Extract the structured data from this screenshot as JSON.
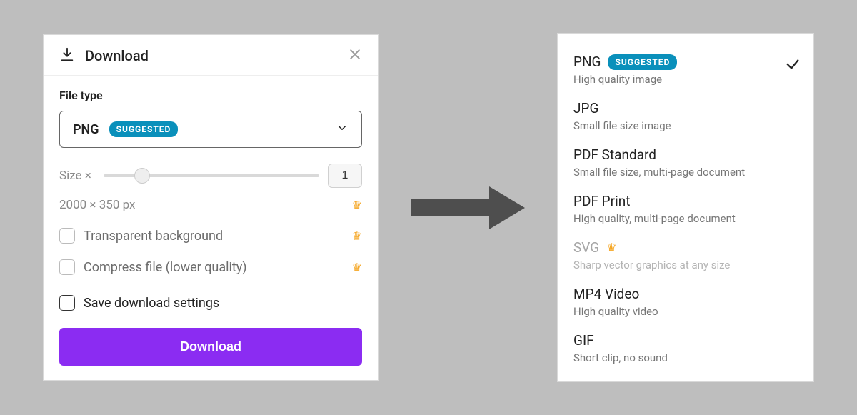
{
  "panel": {
    "title": "Download",
    "file_type_label": "File type",
    "selected_type": "PNG",
    "suggested_badge": "SUGGESTED",
    "size_label": "Size ×",
    "size_value": "1",
    "dimensions": "2000 × 350 px",
    "opt_transparent": "Transparent background",
    "opt_compress": "Compress file (lower quality)",
    "opt_save_settings": "Save download settings",
    "download_btn": "Download"
  },
  "types": [
    {
      "name": "PNG",
      "desc": "High quality image",
      "suggested": true,
      "selected": true,
      "pro": false
    },
    {
      "name": "JPG",
      "desc": "Small file size image",
      "suggested": false,
      "selected": false,
      "pro": false
    },
    {
      "name": "PDF Standard",
      "desc": "Small file size, multi-page document",
      "suggested": false,
      "selected": false,
      "pro": false
    },
    {
      "name": "PDF Print",
      "desc": "High quality, multi-page document",
      "suggested": false,
      "selected": false,
      "pro": false
    },
    {
      "name": "SVG",
      "desc": "Sharp vector graphics at any size",
      "suggested": false,
      "selected": false,
      "pro": true
    },
    {
      "name": "MP4 Video",
      "desc": "High quality video",
      "suggested": false,
      "selected": false,
      "pro": false
    },
    {
      "name": "GIF",
      "desc": "Short clip, no sound",
      "suggested": false,
      "selected": false,
      "pro": false
    }
  ]
}
